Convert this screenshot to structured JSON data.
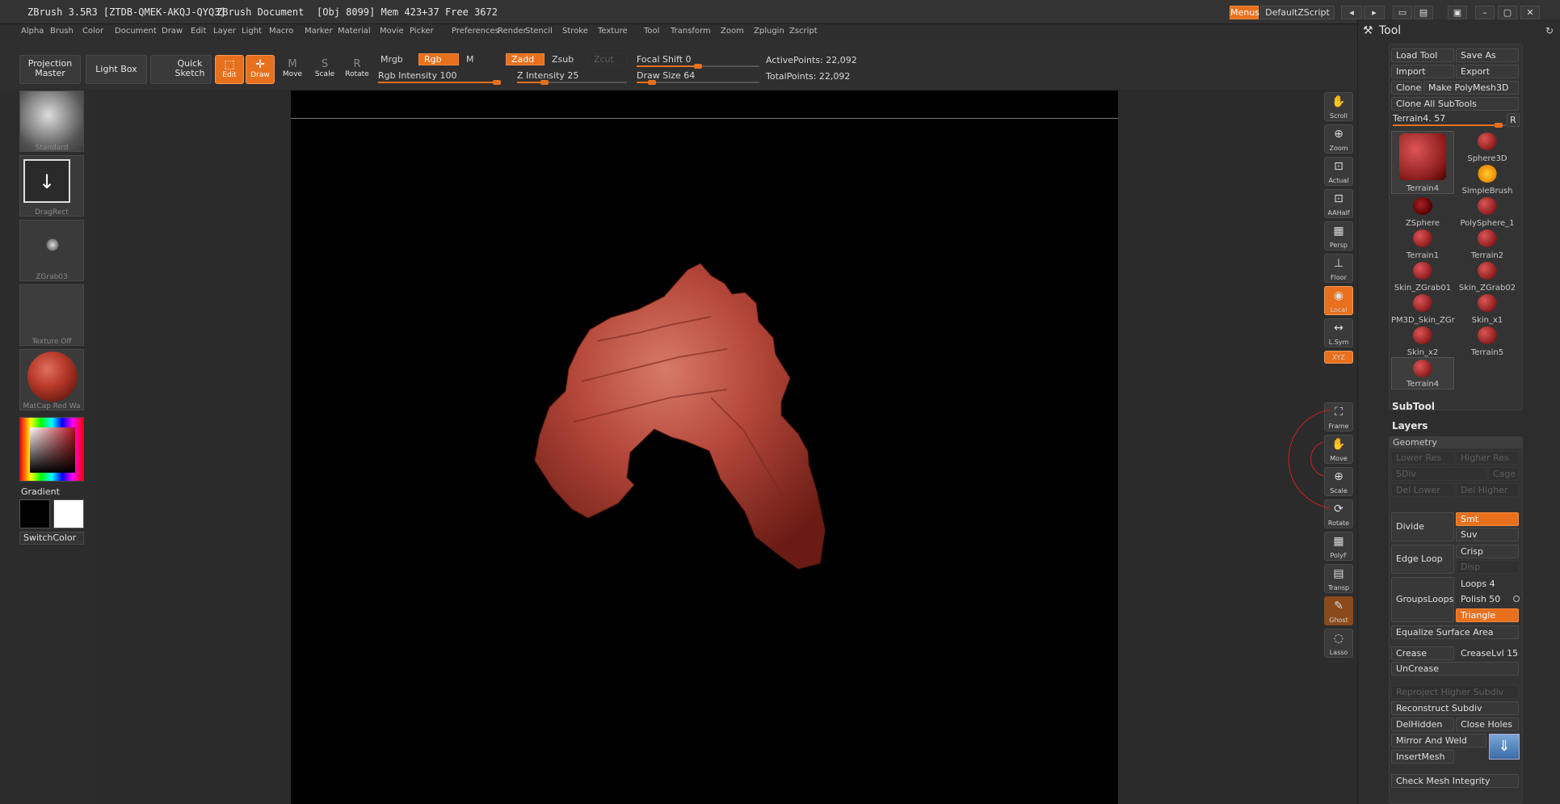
{
  "titlebar": {
    "app": "ZBrush 3.5R3 [ZTDB-QMEK-AKQJ-QYQ3]",
    "doc": "ZBrush Document",
    "stats": "[Obj 8099] Mem 423+37 Free 3672",
    "menus_btn": "Menus",
    "script": "DefaultZScript"
  },
  "menubar": [
    "Alpha",
    "Brush",
    "Color",
    "Document",
    "Draw",
    "Edit",
    "Layer",
    "Light",
    "Macro",
    "Marker",
    "Material",
    "Movie",
    "Picker",
    "Preferences",
    "Render",
    "Stencil",
    "Stroke",
    "Texture",
    "Tool",
    "Transform",
    "Zoom",
    "Zplugin",
    "Zscript"
  ],
  "toolbar": {
    "projection_master": "Projection Master",
    "light_box": "Light Box",
    "quick_sketch": "Quick Sketch",
    "edit": "Edit",
    "draw": "Draw",
    "move": "Move",
    "scale": "Scale",
    "rotate": "Rotate",
    "mrgb": "Mrgb",
    "rgb": "Rgb",
    "m": "M",
    "zadd": "Zadd",
    "zsub": "Zsub",
    "zcut": "Zcut",
    "rgb_intensity": "Rgb Intensity 100",
    "z_intensity": "Z Intensity 25",
    "focal_shift": "Focal Shift 0",
    "draw_size": "Draw Size 64",
    "active_points": "ActivePoints: 22,092",
    "total_points": "TotalPoints: 22,092",
    "rgb_intensity_value": 100,
    "z_intensity_value": 25,
    "focal_shift_value": 0,
    "draw_size_value": 64
  },
  "leftshelf": {
    "brush": "Standard",
    "stroke": "DragRect",
    "alpha": "ZGrab03",
    "texture": "Texture Off",
    "material": "MatCap Red Wa",
    "gradient": "Gradient",
    "switchcolor": "SwitchColor"
  },
  "rightshelf": [
    "Scroll",
    "Zoom",
    "Actual",
    "AAHalf",
    "Persp",
    "Floor",
    "Local",
    "L.Sym",
    "XYZ",
    "Frame",
    "Move",
    "Scale",
    "Rotate",
    "PolyF",
    "Transp",
    "Ghost",
    "Lasso"
  ],
  "palette": {
    "title": "Tool",
    "load_tool": "Load Tool",
    "save_as": "Save As",
    "import": "Import",
    "export": "Export",
    "clone": "Clone",
    "make_polymesh": "Make PolyMesh3D",
    "clone_all": "Clone All SubTools",
    "current_tool": "Terrain4. 57",
    "r": "R",
    "tools": [
      {
        "name": "Terrain4"
      },
      {
        "name": "Sphere3D"
      },
      {
        "name": "SimpleBrush"
      },
      {
        "name": "ZSphere"
      },
      {
        "name": "PolySphere_1"
      },
      {
        "name": "Terrain1"
      },
      {
        "name": "Terrain2"
      },
      {
        "name": "Skin_ZGrab01"
      },
      {
        "name": "Skin_ZGrab02"
      },
      {
        "name": "PM3D_Skin_ZGr"
      },
      {
        "name": "Skin_x1"
      },
      {
        "name": "Skin_x2"
      },
      {
        "name": "Terrain5"
      },
      {
        "name": "Terrain4"
      }
    ],
    "subtool": "SubTool",
    "layers": "Layers",
    "geometry": "Geometry",
    "lower_res": "Lower Res",
    "higher_res": "Higher Res",
    "sdiv": "SDiv",
    "cage": "Cage",
    "del_lower": "Del Lower",
    "del_higher": "Del Higher",
    "divide": "Divide",
    "smt": "Smt",
    "suv": "Suv",
    "edge_loop": "Edge Loop",
    "crisp": "Crisp",
    "disp": "Disp",
    "loops": "Loops 4",
    "groupsloops": "GroupsLoops",
    "polish": "Polish 50",
    "triangle": "Triangle",
    "equalize": "Equalize Surface Area",
    "crease": "Crease",
    "creaselvl": "CreaseLvl 15",
    "uncrease": "UnCrease",
    "reproject": "Reproject Higher Subdiv",
    "reconstruct": "Reconstruct Subdiv",
    "delhidden": "DelHidden",
    "close_holes": "Close Holes",
    "mirror_weld": "Mirror And Weld",
    "insertmesh": "InsertMesh",
    "check_mesh": "Check Mesh Integrity"
  },
  "colors": {
    "accent": "#e8701d",
    "background": "#2b2b2b",
    "canvas": "#000000"
  }
}
